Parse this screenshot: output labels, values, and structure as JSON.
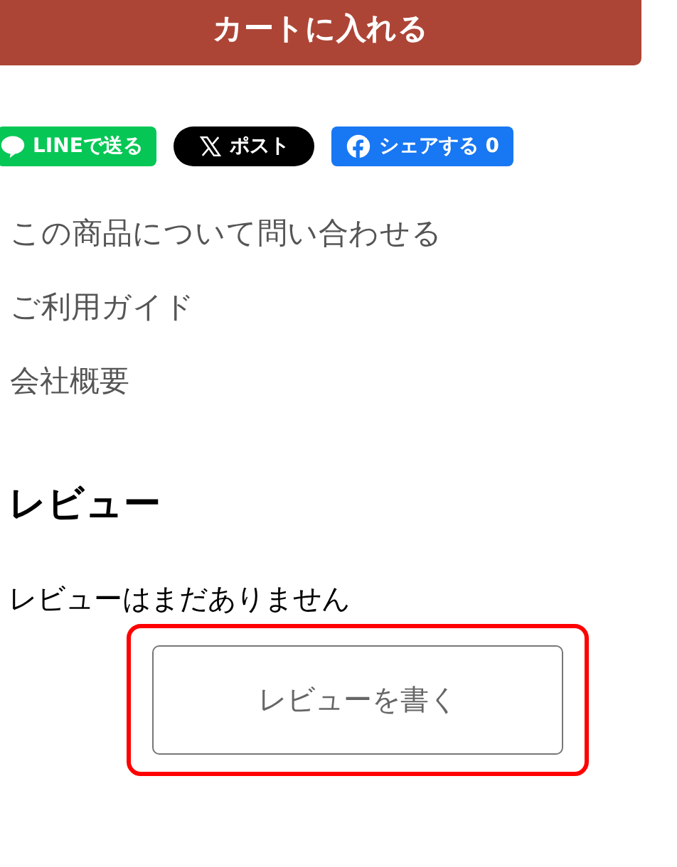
{
  "cart_button": {
    "label": "カートに入れる"
  },
  "share_buttons": [
    {
      "kind": "line",
      "label": "LINEで送る"
    },
    {
      "kind": "x",
      "label": "ポスト"
    },
    {
      "kind": "facebook",
      "label": "シェアする",
      "count": "0"
    }
  ],
  "links": [
    "この商品について問い合わせる",
    "ご利用ガイド",
    "会社概要"
  ],
  "reviews": {
    "heading": "レビュー",
    "empty_message": "レビューはまだありません",
    "write_button": {
      "label": "レビューを書く",
      "highlighted": true
    }
  }
}
